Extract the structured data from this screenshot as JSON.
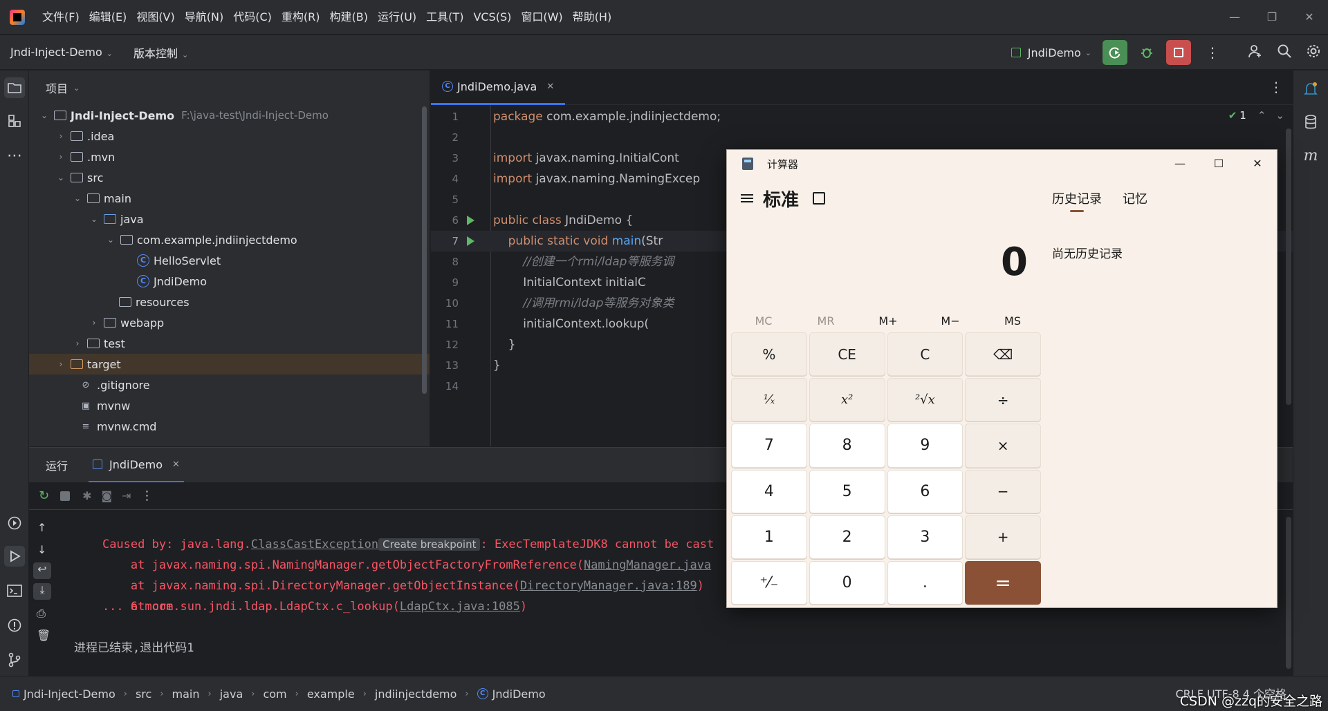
{
  "menu": [
    "文件(F)",
    "编辑(E)",
    "视图(V)",
    "导航(N)",
    "代码(C)",
    "重构(R)",
    "构建(B)",
    "运行(U)",
    "工具(T)",
    "VCS(S)",
    "窗口(W)",
    "帮助(H)"
  ],
  "toolbar": {
    "project_name": "Jndi-Inject-Demo",
    "vcs_label": "版本控制",
    "run_config": "JndiDemo"
  },
  "project": {
    "header": "项目",
    "root_name": "Jndi-Inject-Demo",
    "root_path": "F:\\java-test\\Jndi-Inject-Demo",
    "items": [
      ".idea",
      ".mvn",
      "src",
      "main",
      "java",
      "com.example.jndiinjectdemo",
      "HelloServlet",
      "JndiDemo",
      "resources",
      "webapp",
      "test",
      "target",
      ".gitignore",
      "mvnw",
      "mvnw.cmd"
    ]
  },
  "editor": {
    "tab": "JndiDemo.java",
    "inspection_count": "1",
    "lines": [
      {
        "n": "1",
        "text": "package com.example.jndiinjectdemo;"
      },
      {
        "n": "2",
        "text": ""
      },
      {
        "n": "3",
        "text": "import javax.naming.InitialCont"
      },
      {
        "n": "4",
        "text": "import javax.naming.NamingExcep"
      },
      {
        "n": "5",
        "text": ""
      },
      {
        "n": "6",
        "text": "public class JndiDemo {"
      },
      {
        "n": "7",
        "text": "    public static void main(Str"
      },
      {
        "n": "8",
        "text": "        //创建一个rmi/ldap等服务调"
      },
      {
        "n": "9",
        "text": "        InitialContext initialC"
      },
      {
        "n": "10",
        "text": "        //调用rmi/ldap等服务对象类"
      },
      {
        "n": "11",
        "text": "        initialContext.lookup("
      },
      {
        "n": "12",
        "text": "    }"
      },
      {
        "n": "13",
        "text": "}"
      },
      {
        "n": "14",
        "text": ""
      }
    ]
  },
  "run": {
    "title": "运行",
    "tab": "JndiDemo",
    "caused_by_prefix": "Caused by: java.lang.",
    "exception_link": "ClassCastException",
    "breakpoint_hint": "Create breakpoint",
    "caused_by_suffix": ": ExecTemplateJDK8 cannot be cast",
    "stack": [
      {
        "prefix": "    at javax.naming.spi.NamingManager.getObjectFactoryFromReference(",
        "link": "NamingManager.java",
        "suffix": ""
      },
      {
        "prefix": "    at javax.naming.spi.DirectoryManager.getObjectInstance(",
        "link": "DirectoryManager.java:189",
        "suffix": ")"
      },
      {
        "prefix": "    at com.sun.jndi.ldap.LdapCtx.c_lookup(",
        "link": "LdapCtx.java:1085",
        "suffix": ")"
      }
    ],
    "more": "    ... 6 more",
    "exit_message": "进程已结束,退出代码1"
  },
  "statusbar": {
    "breadcrumbs": [
      "Jndi-Inject-Demo",
      "src",
      "main",
      "java",
      "com",
      "example",
      "jndiinjectdemo",
      "JndiDemo"
    ],
    "right": "CRLF    UTF-8    4 个空格"
  },
  "watermark": "CSDN @zzq的安全之路",
  "calculator": {
    "title": "计算器",
    "mode": "标准",
    "display": "0",
    "memory": [
      "MC",
      "MR",
      "M+",
      "M−",
      "MS"
    ],
    "keys": [
      "%",
      "CE",
      "C",
      "⌫",
      "¹⁄ₓ",
      "x²",
      "²√x",
      "÷",
      "7",
      "8",
      "9",
      "×",
      "4",
      "5",
      "6",
      "−",
      "1",
      "2",
      "3",
      "+",
      "⁺⁄₋",
      "0",
      ".",
      "="
    ],
    "history_tab": "历史记录",
    "memory_tab": "记忆",
    "history_empty": "尚无历史记录",
    "accent_color": "#8a5136"
  },
  "colors": {
    "ide_bg": "#1e1f22",
    "panel_bg": "#2b2d30",
    "keyword": "#cf8e6d",
    "error": "#f75464",
    "run_green": "#5fb865",
    "stop_red": "#db5c5c"
  }
}
